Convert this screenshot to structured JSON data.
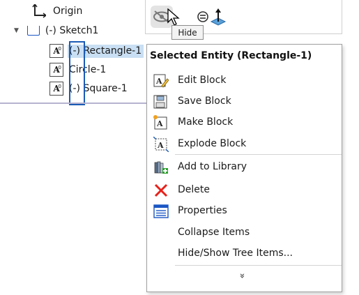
{
  "tree": {
    "origin_label": "Origin",
    "sketch_label": "(-) Sketch1",
    "items": [
      {
        "prefix": "(-)",
        "name": "Rectangle-1",
        "selected": true
      },
      {
        "prefix": "",
        "name": "Circle-1",
        "selected": false
      },
      {
        "prefix": "(-)",
        "name": "Square-1",
        "selected": false
      }
    ]
  },
  "toolbar": {
    "hide_icon": "eye-slash-icon",
    "explode_icon": "explode-icon",
    "normal_icon": "normal-to-icon",
    "tooltip": "Hide"
  },
  "menu": {
    "title": "Selected Entity (Rectangle-1)",
    "items": [
      {
        "label": "Edit Block",
        "icon": "edit-block-icon"
      },
      {
        "label": "Save Block",
        "icon": "save-block-icon"
      },
      {
        "label": "Make Block",
        "icon": "make-block-icon"
      },
      {
        "label": "Explode Block",
        "icon": "explode-block-icon"
      },
      {
        "label": "Add to Library",
        "icon": "add-to-library-icon"
      },
      {
        "label": "Delete",
        "icon": "delete-icon"
      },
      {
        "label": "Properties",
        "icon": "properties-icon"
      },
      {
        "label": "Collapse Items",
        "icon": ""
      },
      {
        "label": "Hide/Show Tree Items...",
        "icon": ""
      }
    ],
    "more_symbol": "»"
  },
  "colors": {
    "selection": "#c9dff3",
    "highlight_outline": "#1a5bb5",
    "delete_red": "#e8201a"
  }
}
